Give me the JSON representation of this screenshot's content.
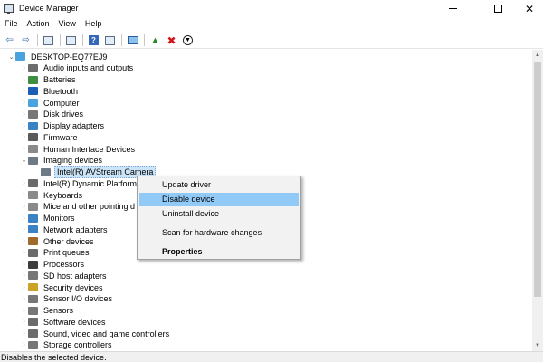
{
  "window": {
    "title": "Device Manager",
    "close_glyph": "✕"
  },
  "menu": [
    "File",
    "Action",
    "View",
    "Help"
  ],
  "toolbar": [
    {
      "name": "back-arrow-icon",
      "glyph": "⇦"
    },
    {
      "name": "forward-arrow-icon",
      "glyph": "⇨"
    },
    {
      "name": "sep"
    },
    {
      "name": "properties-sheet-icon",
      "kind": "box"
    },
    {
      "name": "sep"
    },
    {
      "name": "device-view-icon",
      "kind": "box"
    },
    {
      "name": "sep"
    },
    {
      "name": "help-icon",
      "kind": "help",
      "glyph": "?"
    },
    {
      "name": "view-pane-icon",
      "kind": "box"
    },
    {
      "name": "sep"
    },
    {
      "name": "scan-monitor-icon",
      "kind": "mon"
    },
    {
      "name": "sep"
    },
    {
      "name": "update-driver-icon",
      "kind": "green",
      "glyph": "▲"
    },
    {
      "name": "uninstall-red-x-icon",
      "kind": "red",
      "glyph": "✖"
    },
    {
      "name": "disable-device-icon",
      "kind": "down",
      "glyph": "▼"
    }
  ],
  "tree": {
    "root": "DESKTOP-EQ77EJ9",
    "items": [
      {
        "label": "Audio inputs and outputs",
        "icon": "audio-icon",
        "color": "#6b6b6b",
        "state": "collapsed",
        "level": 1
      },
      {
        "label": "Batteries",
        "icon": "battery-icon",
        "color": "#3e8e41",
        "state": "collapsed",
        "level": 1
      },
      {
        "label": "Bluetooth",
        "icon": "bluetooth-icon",
        "color": "#1a5fb4",
        "state": "collapsed",
        "level": 1
      },
      {
        "label": "Computer",
        "icon": "computer-icon",
        "color": "#4aa3df",
        "state": "collapsed",
        "level": 1
      },
      {
        "label": "Disk drives",
        "icon": "disk-drive-icon",
        "color": "#777777",
        "state": "collapsed",
        "level": 1
      },
      {
        "label": "Display adapters",
        "icon": "display-adapter-icon",
        "color": "#3b82c4",
        "state": "collapsed",
        "level": 1
      },
      {
        "label": "Firmware",
        "icon": "firmware-icon",
        "color": "#5a5a5a",
        "state": "collapsed",
        "level": 1
      },
      {
        "label": "Human Interface Devices",
        "icon": "hid-icon",
        "color": "#8a8a8a",
        "state": "collapsed",
        "level": 1
      },
      {
        "label": "Imaging devices",
        "icon": "imaging-devices-icon",
        "color": "#6e7a86",
        "state": "expanded",
        "level": 1
      },
      {
        "label": "Intel(R) AVStream Camera",
        "icon": "camera-icon",
        "color": "#6e7a86",
        "state": "leaf",
        "level": 2,
        "selected": true
      },
      {
        "label": "Intel(R) Dynamic Platform",
        "icon": "platform-icon",
        "color": "#6b6b6b",
        "state": "collapsed",
        "level": 1
      },
      {
        "label": "Keyboards",
        "icon": "keyboard-icon",
        "color": "#8a8a8a",
        "state": "collapsed",
        "level": 1
      },
      {
        "label": "Mice and other pointing d",
        "icon": "mouse-icon",
        "color": "#8a8a8a",
        "state": "collapsed",
        "level": 1
      },
      {
        "label": "Monitors",
        "icon": "monitor-icon",
        "color": "#3b82c4",
        "state": "collapsed",
        "level": 1
      },
      {
        "label": "Network adapters",
        "icon": "network-adapter-icon",
        "color": "#3b82c4",
        "state": "collapsed",
        "level": 1
      },
      {
        "label": "Other devices",
        "icon": "other-devices-icon",
        "color": "#a06a2a",
        "state": "collapsed",
        "level": 1
      },
      {
        "label": "Print queues",
        "icon": "printer-icon",
        "color": "#6b6b6b",
        "state": "collapsed",
        "level": 1
      },
      {
        "label": "Processors",
        "icon": "processor-icon",
        "color": "#3c3c3c",
        "state": "collapsed",
        "level": 1
      },
      {
        "label": "SD host adapters",
        "icon": "sd-adapter-icon",
        "color": "#777777",
        "state": "collapsed",
        "level": 1
      },
      {
        "label": "Security devices",
        "icon": "security-icon",
        "color": "#c9a227",
        "state": "collapsed",
        "level": 1
      },
      {
        "label": "Sensor I/O devices",
        "icon": "sensor-io-icon",
        "color": "#777777",
        "state": "collapsed",
        "level": 1
      },
      {
        "label": "Sensors",
        "icon": "sensor-icon",
        "color": "#777777",
        "state": "collapsed",
        "level": 1
      },
      {
        "label": "Software devices",
        "icon": "software-device-icon",
        "color": "#6b6b6b",
        "state": "collapsed",
        "level": 1
      },
      {
        "label": "Sound, video and game controllers",
        "icon": "sound-icon",
        "color": "#6b6b6b",
        "state": "collapsed",
        "level": 1
      },
      {
        "label": "Storage controllers",
        "icon": "storage-controller-icon",
        "color": "#777777",
        "state": "collapsed",
        "level": 1
      }
    ]
  },
  "context_menu": [
    {
      "label": "Update driver",
      "name": "ctx-update-driver"
    },
    {
      "label": "Disable device",
      "name": "ctx-disable-device",
      "highlighted": true
    },
    {
      "label": "Uninstall device",
      "name": "ctx-uninstall-device"
    },
    {
      "sep": true
    },
    {
      "label": "Scan for hardware changes",
      "name": "ctx-scan-hardware"
    },
    {
      "sep": true
    },
    {
      "label": "Properties",
      "name": "ctx-properties",
      "bold": true
    }
  ],
  "statusbar": {
    "text": "Disables the selected device."
  },
  "colors": {
    "accent": "#91c9f7",
    "selection": "#cce4f7"
  }
}
